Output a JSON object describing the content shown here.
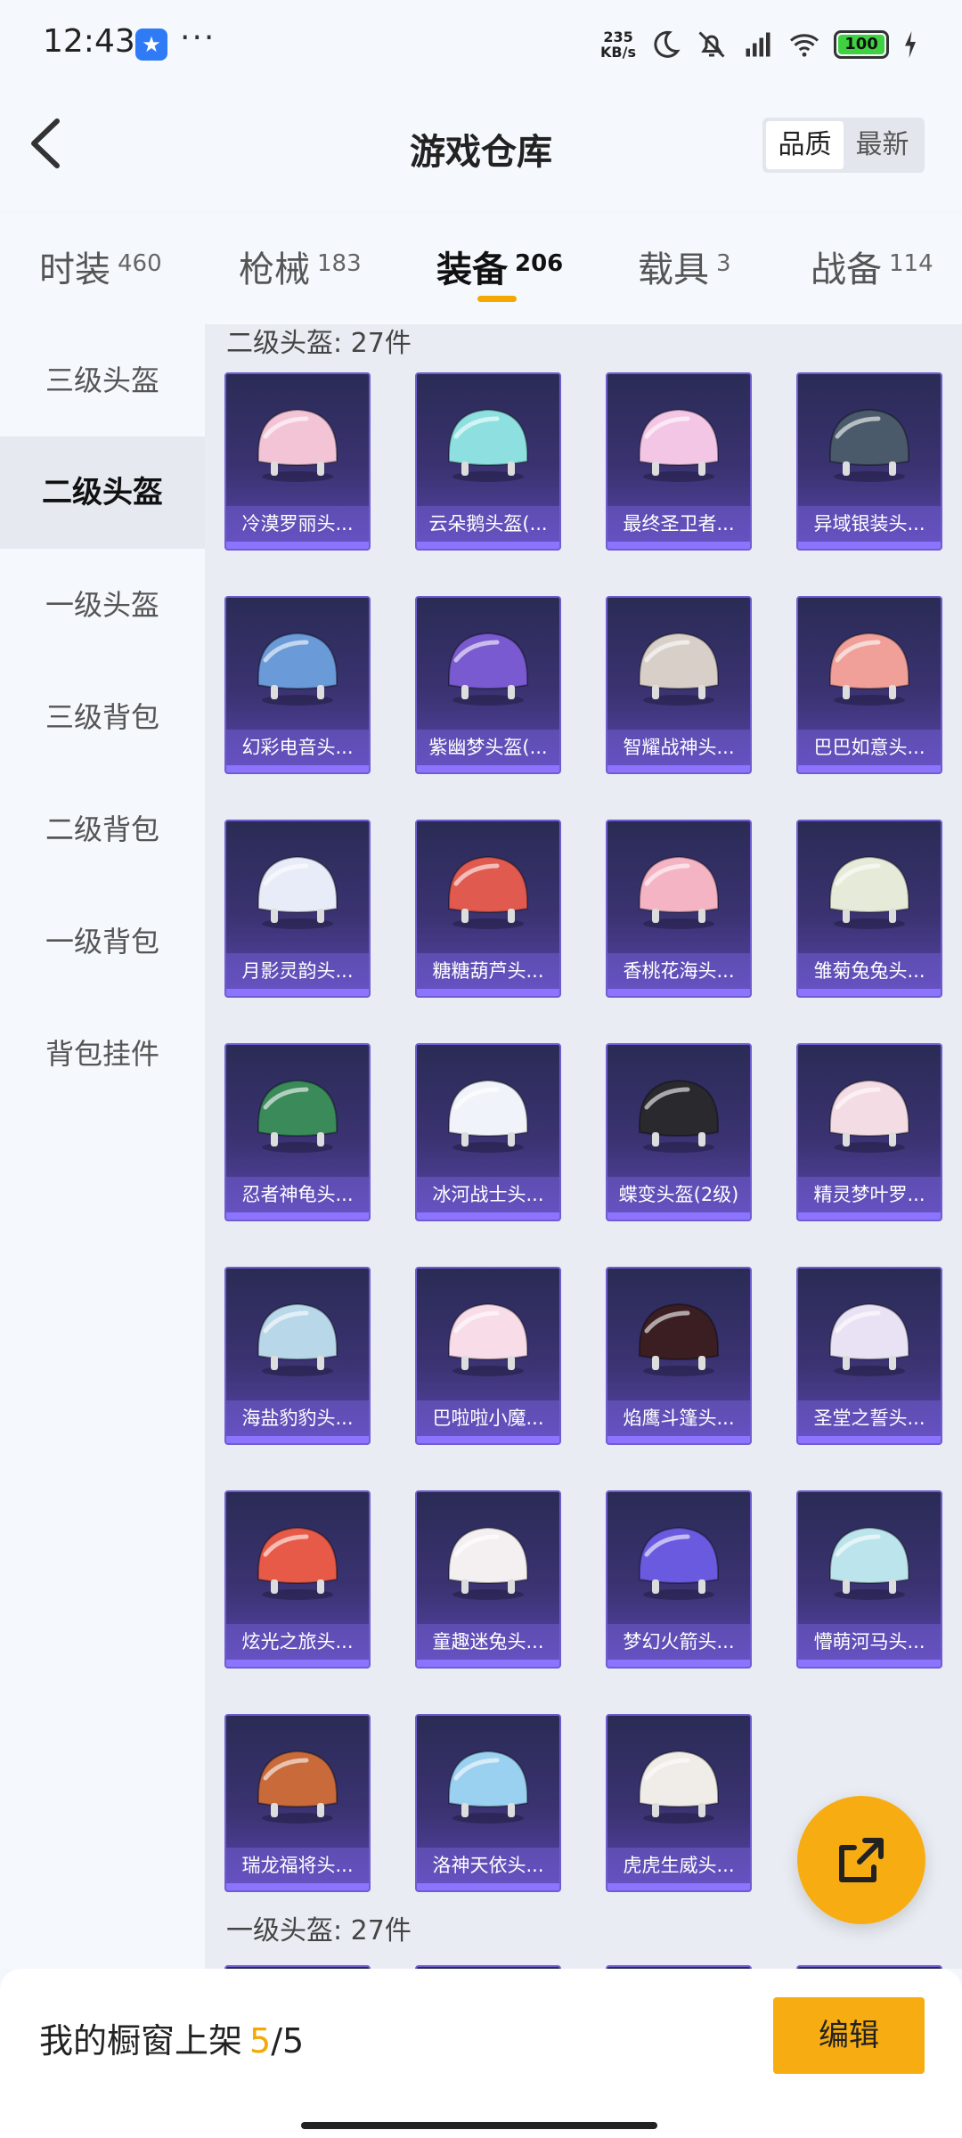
{
  "status_bar": {
    "time": "12:43",
    "net_speed_value": "235",
    "net_speed_unit": "KB/s",
    "battery": "100",
    "icons": [
      "app-icon",
      "moon-icon",
      "mute-icon",
      "signal-icon",
      "wifi-icon",
      "battery-icon",
      "charging-icon"
    ]
  },
  "header": {
    "title": "游戏仓库",
    "sort_options": [
      "品质",
      "最新"
    ],
    "sort_selected": "品质"
  },
  "tabs": [
    {
      "label": "时装",
      "count": "460"
    },
    {
      "label": "枪械",
      "count": "183"
    },
    {
      "label": "装备",
      "count": "206"
    },
    {
      "label": "载具",
      "count": "3"
    },
    {
      "label": "战备",
      "count": "114"
    }
  ],
  "active_tab": "装备",
  "sidebar": {
    "items": [
      "三级头盔",
      "二级头盔",
      "一级头盔",
      "三级背包",
      "二级背包",
      "一级背包",
      "背包挂件"
    ],
    "active": "二级头盔"
  },
  "sections": [
    {
      "title": "二级头盔: 27件",
      "items": [
        {
          "name": "冷漠罗丽头...",
          "color": "#f2c4d6"
        },
        {
          "name": "云朵鹅头盔(...",
          "color": "#8ee0e0"
        },
        {
          "name": "最终圣卫者...",
          "color": "#f4c6e6"
        },
        {
          "name": "异域银装头...",
          "color": "#4a5a6a"
        },
        {
          "name": "幻彩电音头...",
          "color": "#6a9ad8"
        },
        {
          "name": "紫幽梦头盔(...",
          "color": "#7a5ad0"
        },
        {
          "name": "智耀战神头...",
          "color": "#d8d0c8"
        },
        {
          "name": "巴巴如意头...",
          "color": "#f0a098"
        },
        {
          "name": "月影灵韵头...",
          "color": "#e8ecf8"
        },
        {
          "name": "糖糖葫芦头...",
          "color": "#e05a50"
        },
        {
          "name": "香桃花海头...",
          "color": "#f4b4c4"
        },
        {
          "name": "雏菊兔兔头...",
          "color": "#e6ead8"
        },
        {
          "name": "忍者神龟头...",
          "color": "#3a8a5a"
        },
        {
          "name": "冰河战士头...",
          "color": "#f0f4fa"
        },
        {
          "name": "蝶变头盔(2级)",
          "color": "#2a2a2e"
        },
        {
          "name": "精灵梦叶罗...",
          "color": "#f4dce4"
        },
        {
          "name": "海盐豹豹头...",
          "color": "#b8d8ea"
        },
        {
          "name": "巴啦啦小魔...",
          "color": "#f8dce8"
        },
        {
          "name": "焰鹰斗篷头...",
          "color": "#3a1e22"
        },
        {
          "name": "圣堂之誓头...",
          "color": "#e8e2f4"
        },
        {
          "name": "炫光之旅头...",
          "color": "#e85a48"
        },
        {
          "name": "童趣迷兔头...",
          "color": "#f4f0f2"
        },
        {
          "name": "梦幻火箭头...",
          "color": "#6a5ae0"
        },
        {
          "name": "懵萌河马头...",
          "color": "#bce4ec"
        },
        {
          "name": "瑞龙福将头...",
          "color": "#c86a3a"
        },
        {
          "name": "洛神天依头...",
          "color": "#9ad0f0"
        },
        {
          "name": "虎虎生威头...",
          "color": "#f0ece8"
        }
      ]
    },
    {
      "title": "一级头盔: 27件",
      "items": []
    }
  ],
  "bottom_bar": {
    "shelf_label": "我的橱窗上架",
    "shelf_current": "5",
    "shelf_total": "/5",
    "edit_label": "编辑"
  },
  "colors": {
    "accent": "#f7ad12",
    "card_bg": "#3b3372",
    "card_border": "#6f5dd0"
  }
}
